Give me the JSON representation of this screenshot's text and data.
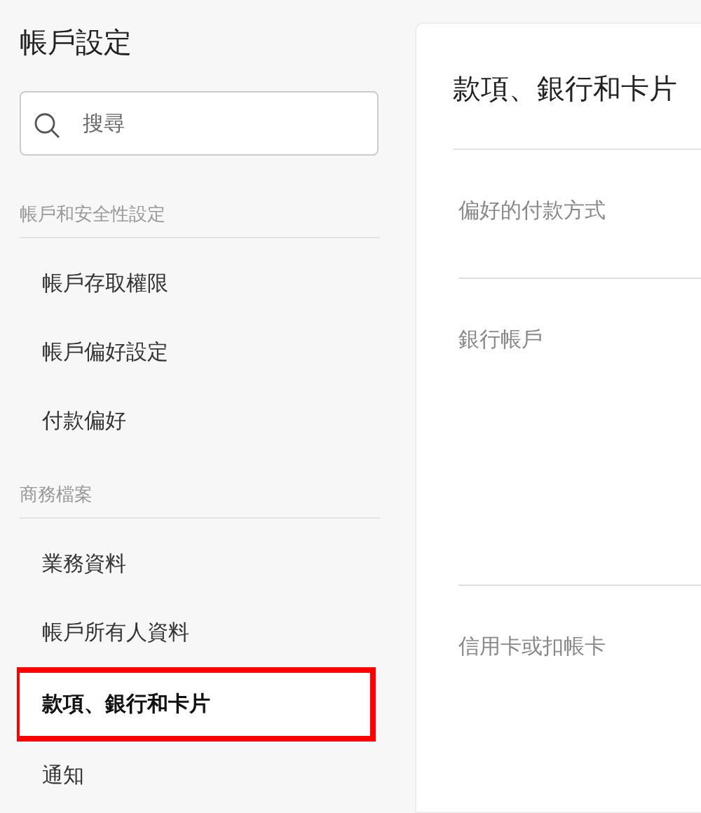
{
  "sidebar": {
    "title": "帳戶設定",
    "search": {
      "placeholder": "搜尋"
    },
    "groups": [
      {
        "label": "帳戶和安全性設定",
        "items": [
          {
            "label": "帳戶存取權限",
            "selected": false,
            "highlighted": false
          },
          {
            "label": "帳戶偏好設定",
            "selected": false,
            "highlighted": false
          },
          {
            "label": "付款偏好",
            "selected": false,
            "highlighted": false
          }
        ]
      },
      {
        "label": "商務檔案",
        "items": [
          {
            "label": "業務資料",
            "selected": false,
            "highlighted": false
          },
          {
            "label": "帳戶所有人資料",
            "selected": false,
            "highlighted": false
          },
          {
            "label": "款項、銀行和卡片",
            "selected": true,
            "highlighted": true
          },
          {
            "label": "通知",
            "selected": false,
            "highlighted": false
          }
        ]
      }
    ]
  },
  "main": {
    "title": "款項、銀行和卡片",
    "sections": [
      {
        "label": "偏好的付款方式"
      },
      {
        "label": "銀行帳戶"
      },
      {
        "label": "信用卡或扣帳卡"
      }
    ]
  }
}
